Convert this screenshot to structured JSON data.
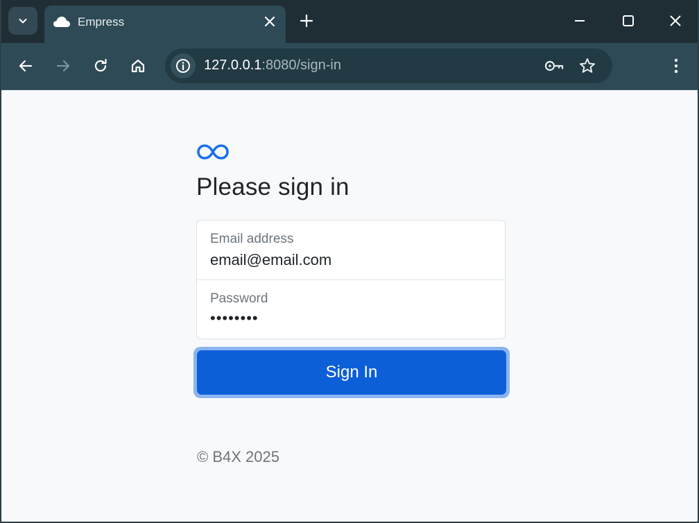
{
  "browser": {
    "tab_title": "Empress",
    "url_host": "127.0.0.1",
    "url_path": ":8080/sign-in",
    "icons": {
      "tab_search": "chevron-down-icon",
      "favicon": "cloud-icon",
      "tab_close": "close-icon",
      "new_tab": "plus-icon",
      "minimize": "minimize-icon",
      "maximize": "maximize-icon",
      "close_window": "close-icon",
      "back": "arrow-left-icon",
      "forward": "arrow-right-icon",
      "reload": "reload-icon",
      "home": "home-icon",
      "site_info": "info-icon",
      "password_key": "key-icon",
      "bookmark": "star-icon",
      "menu": "kebab-menu-icon"
    }
  },
  "page": {
    "logo_icon": "infinity-icon",
    "heading": "Please sign in",
    "email": {
      "label": "Email address",
      "value": "email@email.com"
    },
    "password": {
      "label": "Password",
      "value": "••••••••"
    },
    "submit_label": "Sign In",
    "footer": "© B4X 2025",
    "colors": {
      "accent": "#0d5fd8",
      "focus_ring": "#8ab4f2",
      "logo": "#1a6ff0"
    }
  }
}
